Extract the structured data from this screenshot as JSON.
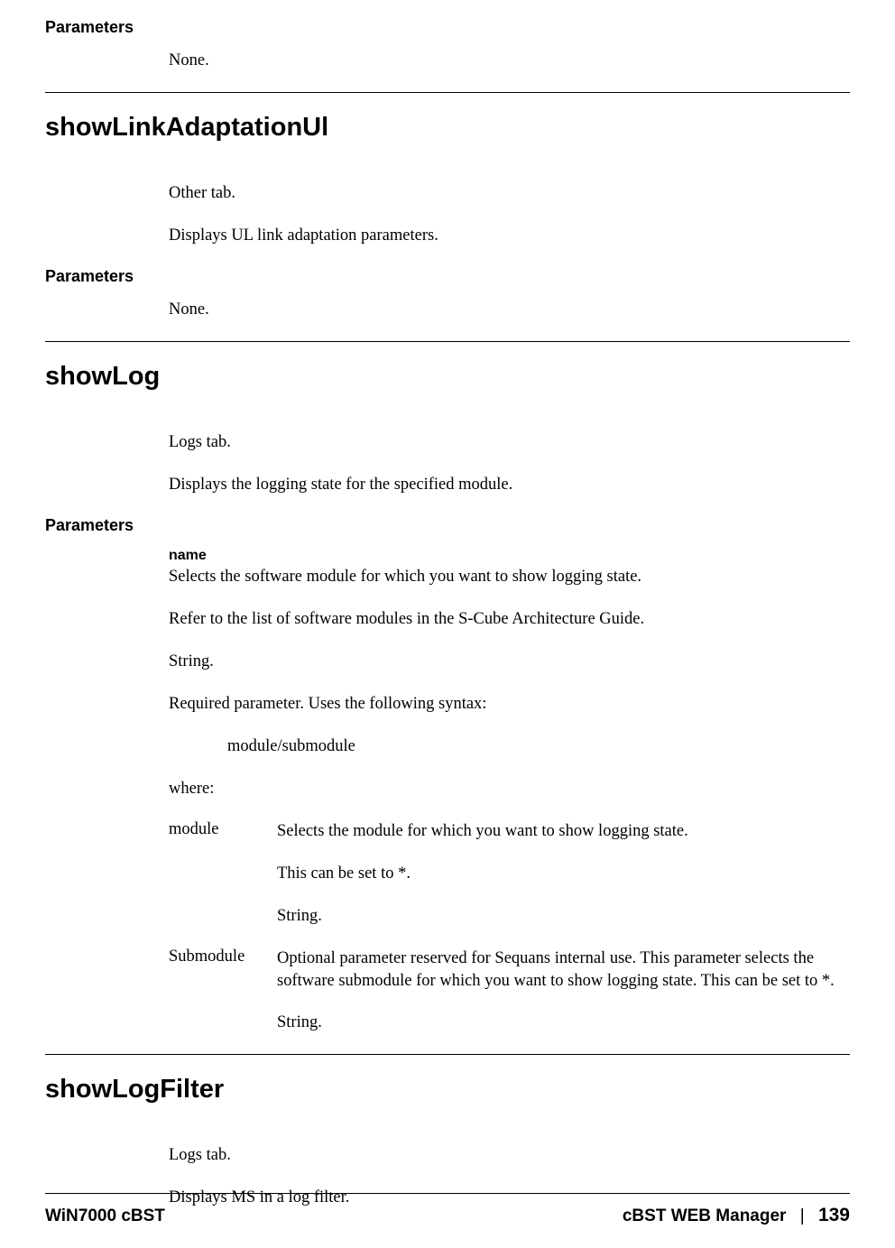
{
  "sec1": {
    "params_heading": "Parameters",
    "body_none": "None."
  },
  "sec2": {
    "title": "showLinkAdaptationUl",
    "body_tab": "Other tab.",
    "body_desc": "Displays UL link adaptation parameters.",
    "params_heading": "Parameters",
    "body_none": "None."
  },
  "sec3": {
    "title": "showLog",
    "body_tab": "Logs tab.",
    "body_desc": "Displays the logging state for the specified module.",
    "params_heading": "Parameters",
    "param_name": "name",
    "p1": "Selects the software module for which you want to show logging state.",
    "p2": "Refer to the list of software modules in the S-Cube Architecture Guide.",
    "p3": "String.",
    "p4": "Required parameter. Uses the following syntax:",
    "syntax": "module/submodule",
    "p5": "where:",
    "row1_label": "module",
    "row1_a": "Selects the module for which you want to show logging state.",
    "row1_b": "This can be set to *.",
    "row1_c": "String.",
    "row2_label": "Submodule",
    "row2_a": "Optional parameter reserved for Sequans internal use. This parameter selects the software submodule for which you want to show logging state. This can be set to *.",
    "row2_b": "String."
  },
  "sec4": {
    "title": "showLogFilter",
    "body_tab": "Logs tab.",
    "body_desc": "Displays MS in a log filter."
  },
  "footer": {
    "left": "WiN7000 cBST",
    "right_title": "cBST WEB Manager",
    "separator": "|",
    "page": "139"
  }
}
